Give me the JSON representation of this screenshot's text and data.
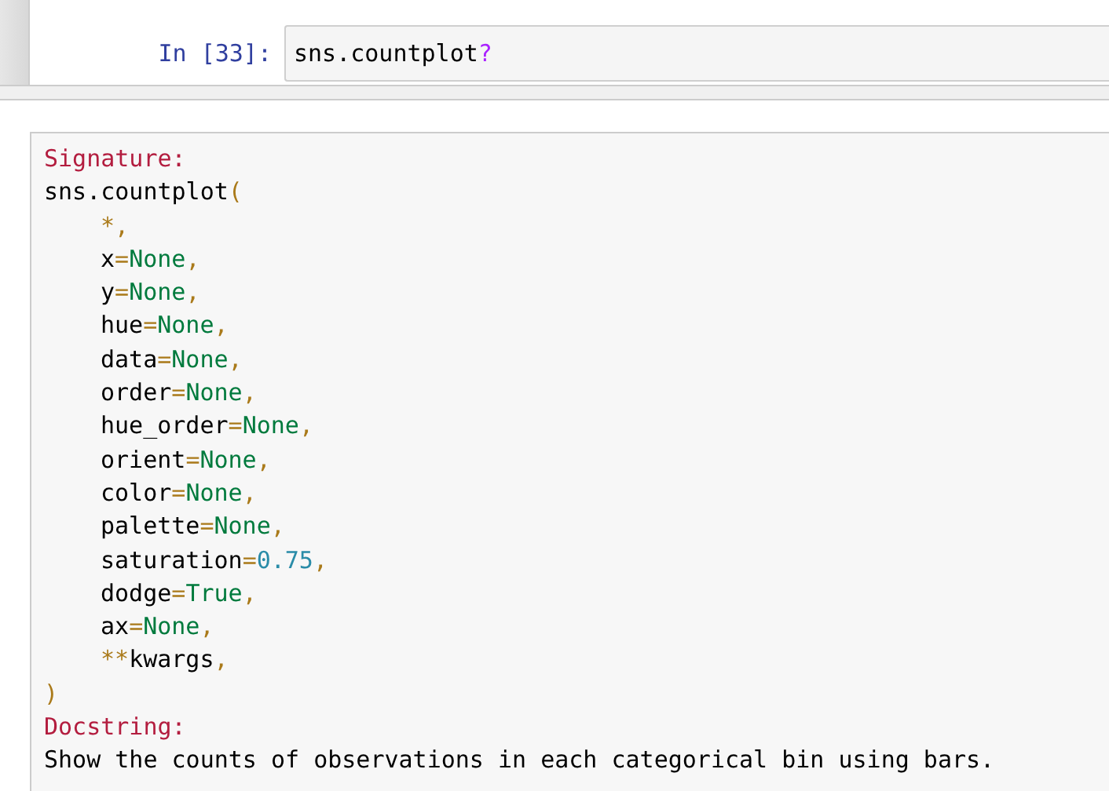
{
  "cell": {
    "prompt": "In [33]:",
    "code": [
      {
        "text": "sns.countplot",
        "kind": "name"
      },
      {
        "text": "?",
        "kind": "magic"
      }
    ]
  },
  "pager": {
    "lines": [
      {
        "indented": false,
        "tokens": [
          {
            "text": "Signature:",
            "kind": "header"
          }
        ]
      },
      {
        "indented": false,
        "tokens": [
          {
            "text": "sns.countplot",
            "kind": "name"
          },
          {
            "text": "(",
            "kind": "op"
          }
        ]
      },
      {
        "indented": true,
        "tokens": [
          {
            "text": "*,",
            "kind": "op"
          }
        ]
      },
      {
        "indented": true,
        "tokens": [
          {
            "text": "x",
            "kind": "name"
          },
          {
            "text": "=",
            "kind": "op"
          },
          {
            "text": "None",
            "kind": "const"
          },
          {
            "text": ",",
            "kind": "op"
          }
        ]
      },
      {
        "indented": true,
        "tokens": [
          {
            "text": "y",
            "kind": "name"
          },
          {
            "text": "=",
            "kind": "op"
          },
          {
            "text": "None",
            "kind": "const"
          },
          {
            "text": ",",
            "kind": "op"
          }
        ]
      },
      {
        "indented": true,
        "tokens": [
          {
            "text": "hue",
            "kind": "name"
          },
          {
            "text": "=",
            "kind": "op"
          },
          {
            "text": "None",
            "kind": "const"
          },
          {
            "text": ",",
            "kind": "op"
          }
        ]
      },
      {
        "indented": true,
        "tokens": [
          {
            "text": "data",
            "kind": "name"
          },
          {
            "text": "=",
            "kind": "op"
          },
          {
            "text": "None",
            "kind": "const"
          },
          {
            "text": ",",
            "kind": "op"
          }
        ]
      },
      {
        "indented": true,
        "tokens": [
          {
            "text": "order",
            "kind": "name"
          },
          {
            "text": "=",
            "kind": "op"
          },
          {
            "text": "None",
            "kind": "const"
          },
          {
            "text": ",",
            "kind": "op"
          }
        ]
      },
      {
        "indented": true,
        "tokens": [
          {
            "text": "hue_order",
            "kind": "name"
          },
          {
            "text": "=",
            "kind": "op"
          },
          {
            "text": "None",
            "kind": "const"
          },
          {
            "text": ",",
            "kind": "op"
          }
        ]
      },
      {
        "indented": true,
        "tokens": [
          {
            "text": "orient",
            "kind": "name"
          },
          {
            "text": "=",
            "kind": "op"
          },
          {
            "text": "None",
            "kind": "const"
          },
          {
            "text": ",",
            "kind": "op"
          }
        ]
      },
      {
        "indented": true,
        "tokens": [
          {
            "text": "color",
            "kind": "name"
          },
          {
            "text": "=",
            "kind": "op"
          },
          {
            "text": "None",
            "kind": "const"
          },
          {
            "text": ",",
            "kind": "op"
          }
        ]
      },
      {
        "indented": true,
        "tokens": [
          {
            "text": "palette",
            "kind": "name"
          },
          {
            "text": "=",
            "kind": "op"
          },
          {
            "text": "None",
            "kind": "const"
          },
          {
            "text": ",",
            "kind": "op"
          }
        ]
      },
      {
        "indented": true,
        "tokens": [
          {
            "text": "saturation",
            "kind": "name"
          },
          {
            "text": "=",
            "kind": "op"
          },
          {
            "text": "0.75",
            "kind": "num"
          },
          {
            "text": ",",
            "kind": "op"
          }
        ]
      },
      {
        "indented": true,
        "tokens": [
          {
            "text": "dodge",
            "kind": "name"
          },
          {
            "text": "=",
            "kind": "op"
          },
          {
            "text": "True",
            "kind": "const"
          },
          {
            "text": ",",
            "kind": "op"
          }
        ]
      },
      {
        "indented": true,
        "tokens": [
          {
            "text": "ax",
            "kind": "name"
          },
          {
            "text": "=",
            "kind": "op"
          },
          {
            "text": "None",
            "kind": "const"
          },
          {
            "text": ",",
            "kind": "op"
          }
        ]
      },
      {
        "indented": true,
        "tokens": [
          {
            "text": "**",
            "kind": "op"
          },
          {
            "text": "kwargs",
            "kind": "name"
          },
          {
            "text": ",",
            "kind": "op"
          }
        ]
      },
      {
        "indented": false,
        "tokens": [
          {
            "text": ")",
            "kind": "op"
          }
        ]
      },
      {
        "indented": false,
        "tokens": [
          {
            "text": "Docstring:",
            "kind": "header"
          }
        ]
      },
      {
        "indented": false,
        "tokens": [
          {
            "text": "Show the counts of observations in each categorical bin using bars.",
            "kind": "name"
          }
        ]
      }
    ]
  }
}
